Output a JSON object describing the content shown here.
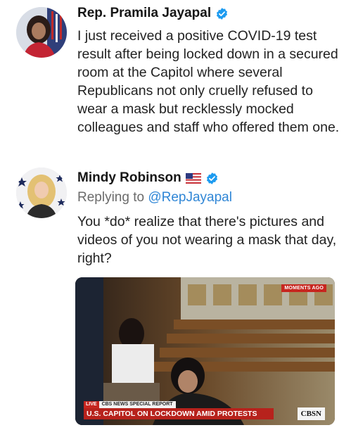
{
  "tweets": [
    {
      "author": "Rep. Pramila Jayapal",
      "verified": true,
      "text": "I just received a positive COVID-19 test result after being locked down in a secured room at the Capitol where several Republicans not only cruelly refused to wear a mask but recklessly mocked colleagues and staff who offered them one."
    },
    {
      "author": "Mindy Robinson",
      "verified": true,
      "flag": "us-flag",
      "replying_prefix": "Replying to",
      "replying_handle": "@RepJayapal",
      "text": "You *do* realize that there's pictures and videos of you not wearing a mask that day, right?",
      "media": {
        "badge": "MOMENTS AGO",
        "live_label": "LIVE",
        "special_label": "CBS NEWS SPECIAL REPORT",
        "headline": "U.S. CAPITOL ON LOCKDOWN AMID PROTESTS",
        "network": "CBSN"
      }
    }
  ],
  "colors": {
    "verified_blue": "#1d9bf0",
    "link_blue": "#2f86d6",
    "cbs_red": "#c7261f"
  },
  "icons": [
    "verified-icon",
    "us-flag-icon",
    "avatar-jayapal",
    "avatar-robinson"
  ]
}
